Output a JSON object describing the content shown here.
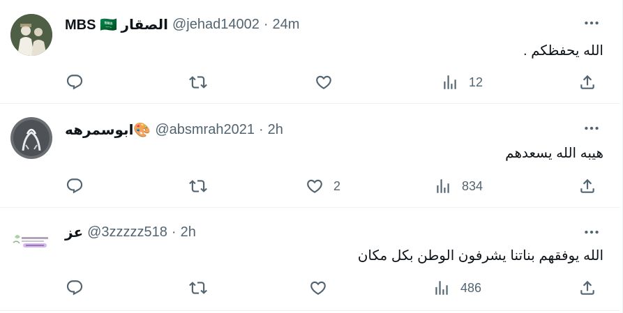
{
  "colors": {
    "text": "#0f1419",
    "muted": "#536471",
    "divider": "#eff3f4"
  },
  "tweets": [
    {
      "name": "MBS 🇸🇦 الصقار",
      "handle": "@jehad14002",
      "dot": "·",
      "time": "24m",
      "text": "الله يحفظكم .",
      "reply_count": "",
      "retweet_count": "",
      "like_count": "",
      "views": "12"
    },
    {
      "name": "ابوسمرهه🎨",
      "handle": "@absmrah2021",
      "dot": "·",
      "time": "2h",
      "text": "هيبه الله يسعدهم",
      "reply_count": "",
      "retweet_count": "",
      "like_count": "2",
      "views": "834"
    },
    {
      "name": "عز",
      "handle": "@3zzzzz518",
      "dot": "·",
      "time": "2h",
      "text": "الله يوفقهم بناتنا يشرفون الوطن بكل مكان",
      "reply_count": "",
      "retweet_count": "",
      "like_count": "",
      "views": "486"
    }
  ]
}
